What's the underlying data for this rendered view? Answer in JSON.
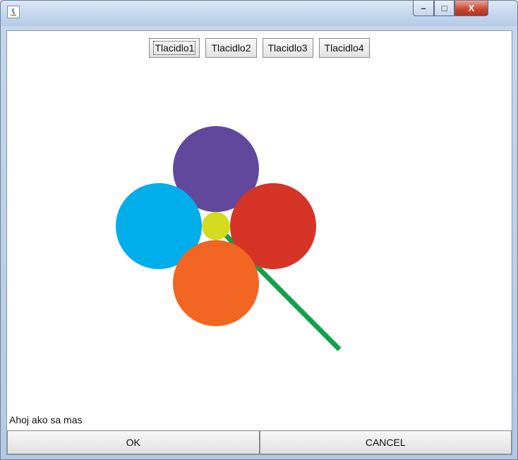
{
  "window": {
    "title": "",
    "controls": {
      "minimize": "–",
      "maximize": "□",
      "close": "X"
    }
  },
  "toolbar": {
    "buttons": [
      "Tlacidlo1",
      "Tlacidlo2",
      "Tlacidlo3",
      "Tlacidlo4"
    ]
  },
  "drawing": {
    "shapes": [
      {
        "name": "top-petal",
        "kind": "circle",
        "color": "#62489c"
      },
      {
        "name": "left-petal",
        "kind": "circle",
        "color": "#00aeec"
      },
      {
        "name": "right-petal",
        "kind": "circle",
        "color": "#d63427"
      },
      {
        "name": "bottom-petal",
        "kind": "circle",
        "color": "#f26522"
      },
      {
        "name": "flower-center",
        "kind": "circle",
        "color": "#d4dc22"
      },
      {
        "name": "stem",
        "kind": "line",
        "color": "#12a14a"
      }
    ]
  },
  "status_text": "Ahoj ako sa mas",
  "bottom_buttons": {
    "ok": "OK",
    "cancel": "CANCEL"
  }
}
